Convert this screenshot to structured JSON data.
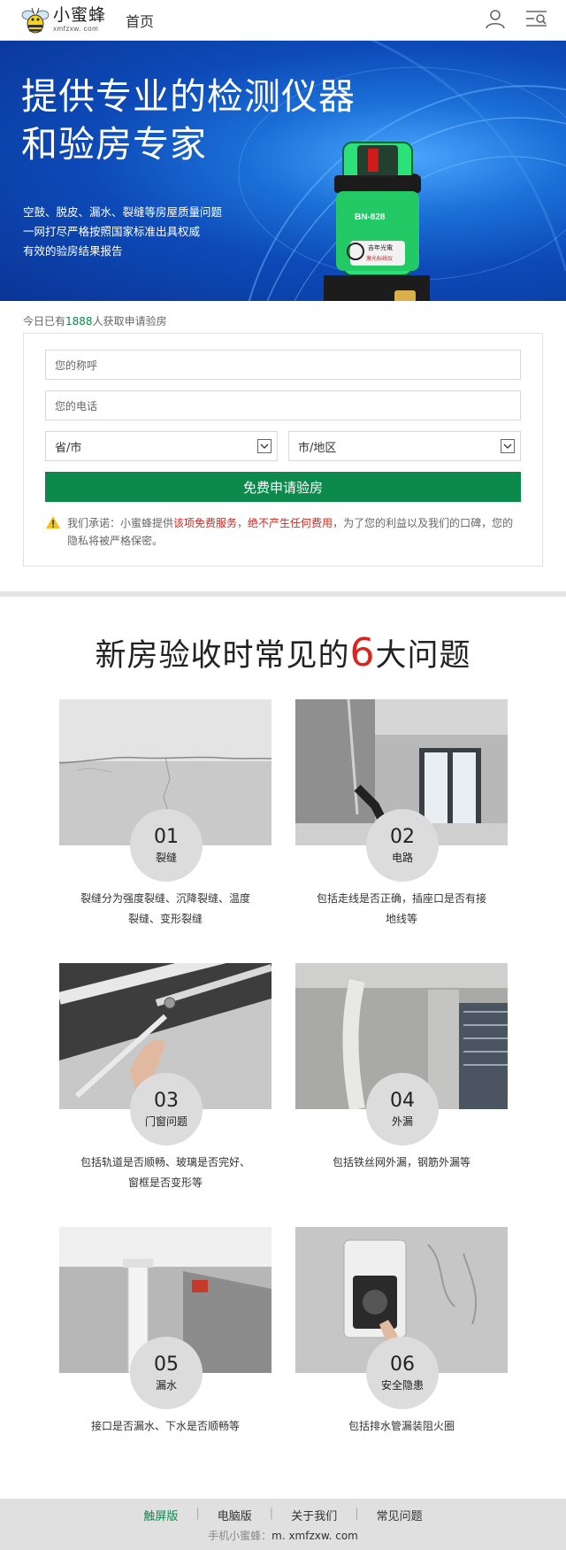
{
  "header": {
    "logo_cn": "小蜜蜂",
    "logo_en": "xmfzxw. com",
    "nav_home": "首页"
  },
  "banner": {
    "title_line1": "提供专业的检测仪器",
    "title_line2": "和验房专家",
    "sub_line1": "空鼓、脱皮、漏水、裂缝等房屋质量问题",
    "sub_line2": "一网打尽严格按照国家标准出具权威",
    "sub_line3": "有效的验房结果报告",
    "device_model": "BN-828",
    "device_brand": "吉年光電",
    "device_brand_sub": "激光标线仪"
  },
  "apply": {
    "prefix": "今日已有",
    "count": "1888",
    "suffix": "人获取申请验房"
  },
  "form": {
    "name_placeholder": "您的称呼",
    "phone_placeholder": "您的电话",
    "province_select": "省/市",
    "city_select": "市/地区",
    "submit_label": "免费申请验房",
    "promise_a": "我们承诺：小蜜蜂提供",
    "promise_b": "该项免费服务",
    "promise_c": "，",
    "promise_d": "绝不产生任何费用",
    "promise_e": "，为了您的利益以及我们的口碑，您的隐私将被严格保密。"
  },
  "problems": {
    "title_pre": "新房验收时常见的",
    "title_num": "6",
    "title_post": "大问题",
    "items": [
      {
        "no": "01",
        "name": "裂缝",
        "desc": "裂缝分为强度裂缝、沉降裂缝、温度裂缝、变形裂缝"
      },
      {
        "no": "02",
        "name": "电路",
        "desc": "包括走线是否正确，插座口是否有接地线等"
      },
      {
        "no": "03",
        "name": "门窗问题",
        "desc": "包括轨道是否顺畅、玻璃是否完好、窗框是否变形等"
      },
      {
        "no": "04",
        "name": "外漏",
        "desc": "包括铁丝网外漏，钢筋外漏等"
      },
      {
        "no": "05",
        "name": "漏水",
        "desc": "接口是否漏水、下水是否顺畅等"
      },
      {
        "no": "06",
        "name": "安全隐患",
        "desc": "包括排水管漏装阻火圈"
      }
    ]
  },
  "footer": {
    "nav": [
      "触屏版",
      "电脑版",
      "关于我们",
      "常见问题"
    ],
    "site_label": "手机小蜜蜂：",
    "site_url": "m. xmfzxw. com"
  },
  "colors": {
    "brand_green": "#0c8a4b",
    "highlight_red": "#d8251d",
    "banner_blue": "#0d4ab8"
  }
}
